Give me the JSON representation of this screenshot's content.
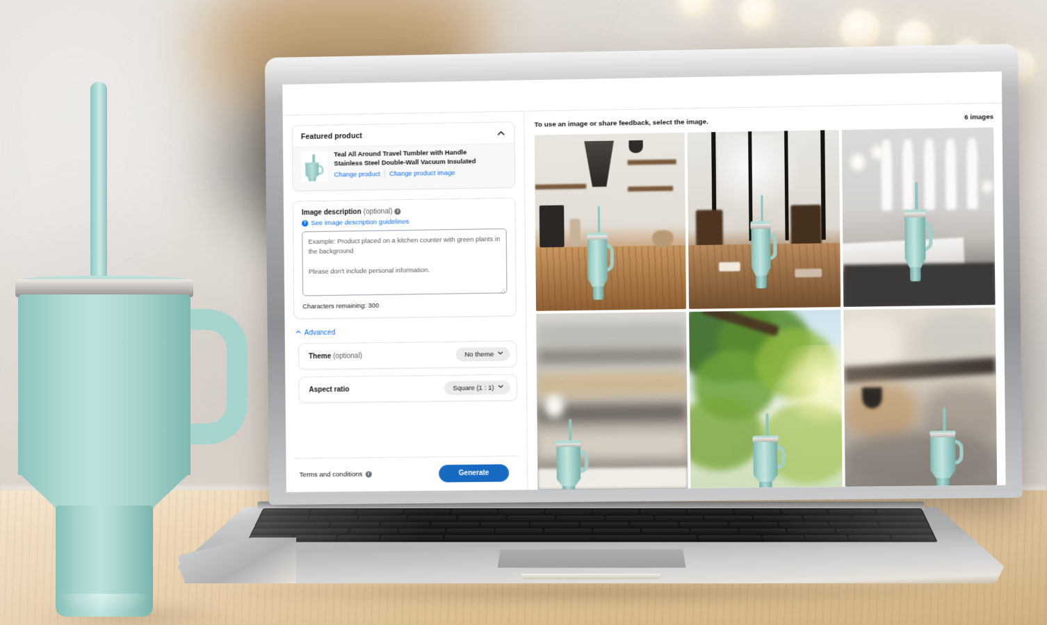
{
  "app": {
    "left_panel": {
      "featured_product": {
        "section_title": "Featured product",
        "collapse_icon": "chevron-up-icon",
        "product_name_line1": "Teal All Around Travel Tumbler with Handle",
        "product_name_line2": "Stainless Steel Double-Wall Vacuum Insulated",
        "change_product_link": "Change product",
        "change_product_image_link": "Change product image"
      },
      "image_description": {
        "label": "Image description",
        "optional_suffix": "(optional)",
        "info_icon": "info-icon",
        "guidelines_icon": "question-circle-icon",
        "guidelines_link": "See image description guidelines",
        "textarea_value": "",
        "textarea_placeholder": "Example: Product placed on a kitchen counter with green plants in the background\n\nPlease don't include personal information.",
        "characters_remaining": "Characters remaining: 300"
      },
      "advanced": {
        "toggle_label": "Advanced",
        "toggle_icon": "chevron-up-icon",
        "theme": {
          "label": "Theme",
          "optional_suffix": "(optional)",
          "selected_value": "No theme",
          "dropdown_icon": "chevron-down-icon"
        },
        "aspect_ratio": {
          "label": "Aspect ratio",
          "selected_value": "Square (1 : 1)",
          "dropdown_icon": "chevron-down-icon"
        }
      },
      "footer": {
        "terms_label": "Terms and conditions",
        "terms_info_icon": "info-icon",
        "generate_button": "Generate"
      }
    },
    "right_panel": {
      "hint": "To use an image or share feedback, select the image.",
      "image_count": "6 images",
      "tiles": [
        {
          "id": "tile-1",
          "scene": "rustic kitchen with range hood, shelves and wooden counter"
        },
        {
          "id": "tile-2",
          "scene": "cafe interior with tall windows and wooden table"
        },
        {
          "id": "tile-3",
          "scene": "bright restaurant with arched windows and white table"
        },
        {
          "id": "tile-4",
          "scene": "blurred warm interior with bokeh light"
        },
        {
          "id": "tile-5",
          "scene": "outdoors under a sunlit green tree canopy"
        },
        {
          "id": "tile-6",
          "scene": "warm blurred industrial cafe interior"
        }
      ]
    }
  },
  "colors": {
    "accent_blue": "#1769c2",
    "link_blue": "#0d6efd",
    "product_teal": "#a9d6d0",
    "panel_border": "#e3e5e8",
    "text_primary": "#0f1111",
    "text_secondary": "#565959"
  }
}
